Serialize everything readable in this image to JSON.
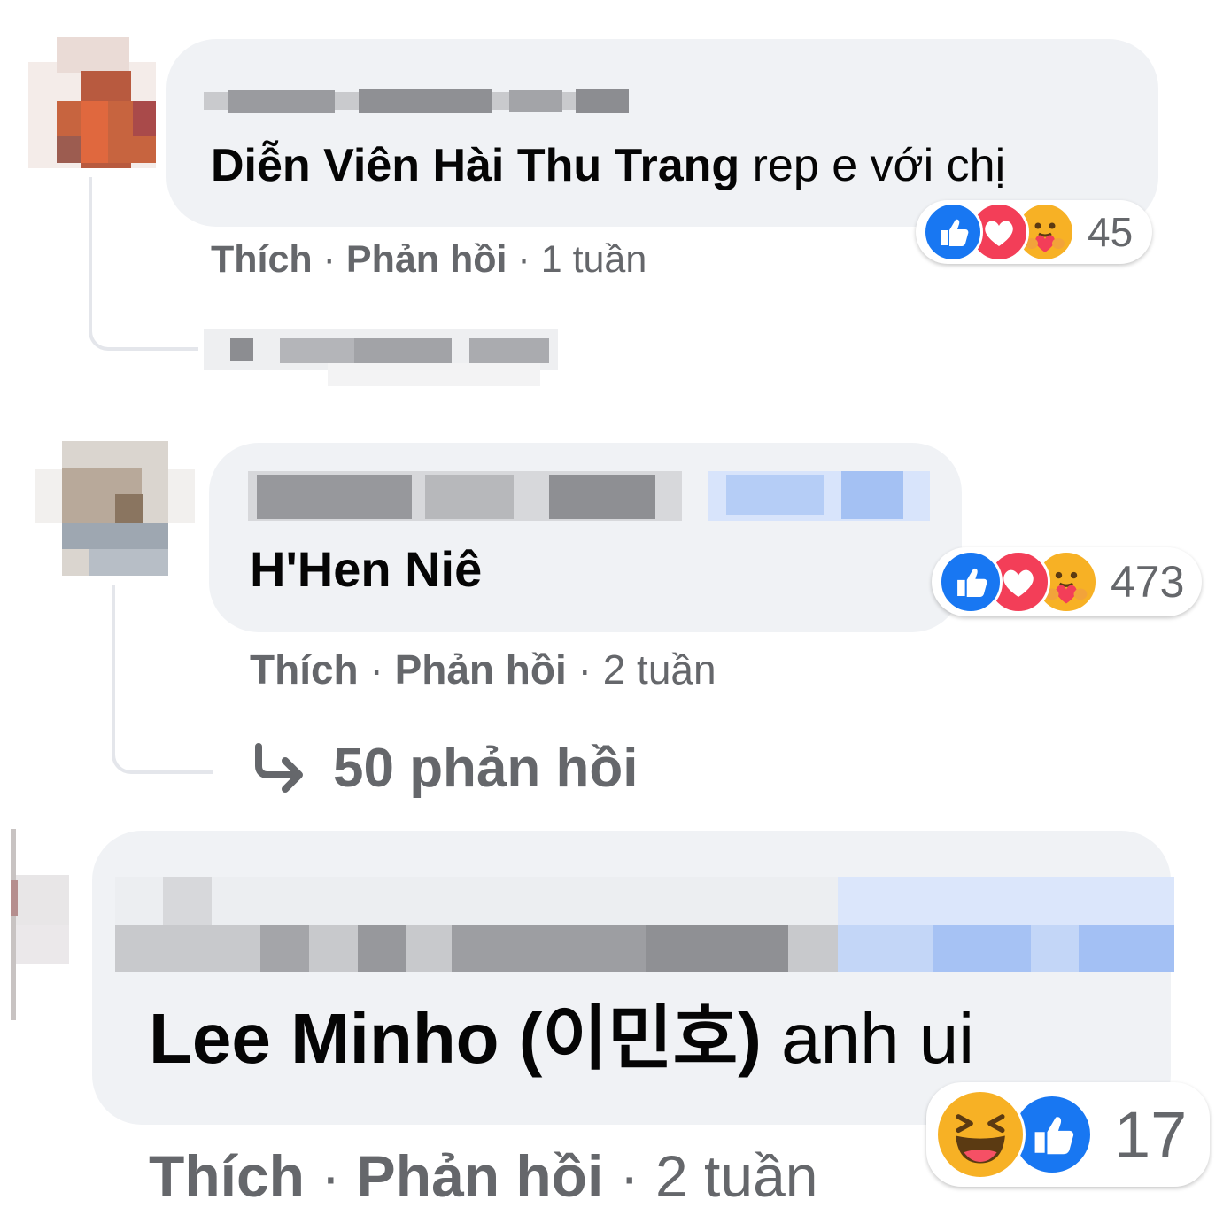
{
  "comments": [
    {
      "mention": "Diễn Viên Hài Thu Trang",
      "text": " rep e với chị",
      "like_label": "Thích",
      "reply_label": "Phản hồi",
      "time": "1 tuần",
      "reactions": [
        "like-icon",
        "love-icon",
        "care-icon"
      ],
      "reaction_count": "45"
    },
    {
      "mention": "H'Hen Niê",
      "text": "",
      "like_label": "Thích",
      "reply_label": "Phản hồi",
      "time": "2 tuần",
      "reactions": [
        "like-icon",
        "love-icon",
        "care-icon"
      ],
      "reaction_count": "473",
      "replies_label": "50 phản hồi"
    },
    {
      "mention": "Lee Minho (이민호)",
      "text": " anh ui",
      "like_label": "Thích",
      "reply_label": "Phản hồi",
      "time": "2 tuần",
      "reactions": [
        "haha-icon",
        "like-icon"
      ],
      "reaction_count": "17"
    }
  ],
  "separator": "·",
  "colors": {
    "bubble": "#f0f2f5",
    "meta_text": "#65676b",
    "like_blue": "#1877f2",
    "love_red": "#f33e58",
    "emoji_yellow": "#f7b125"
  }
}
